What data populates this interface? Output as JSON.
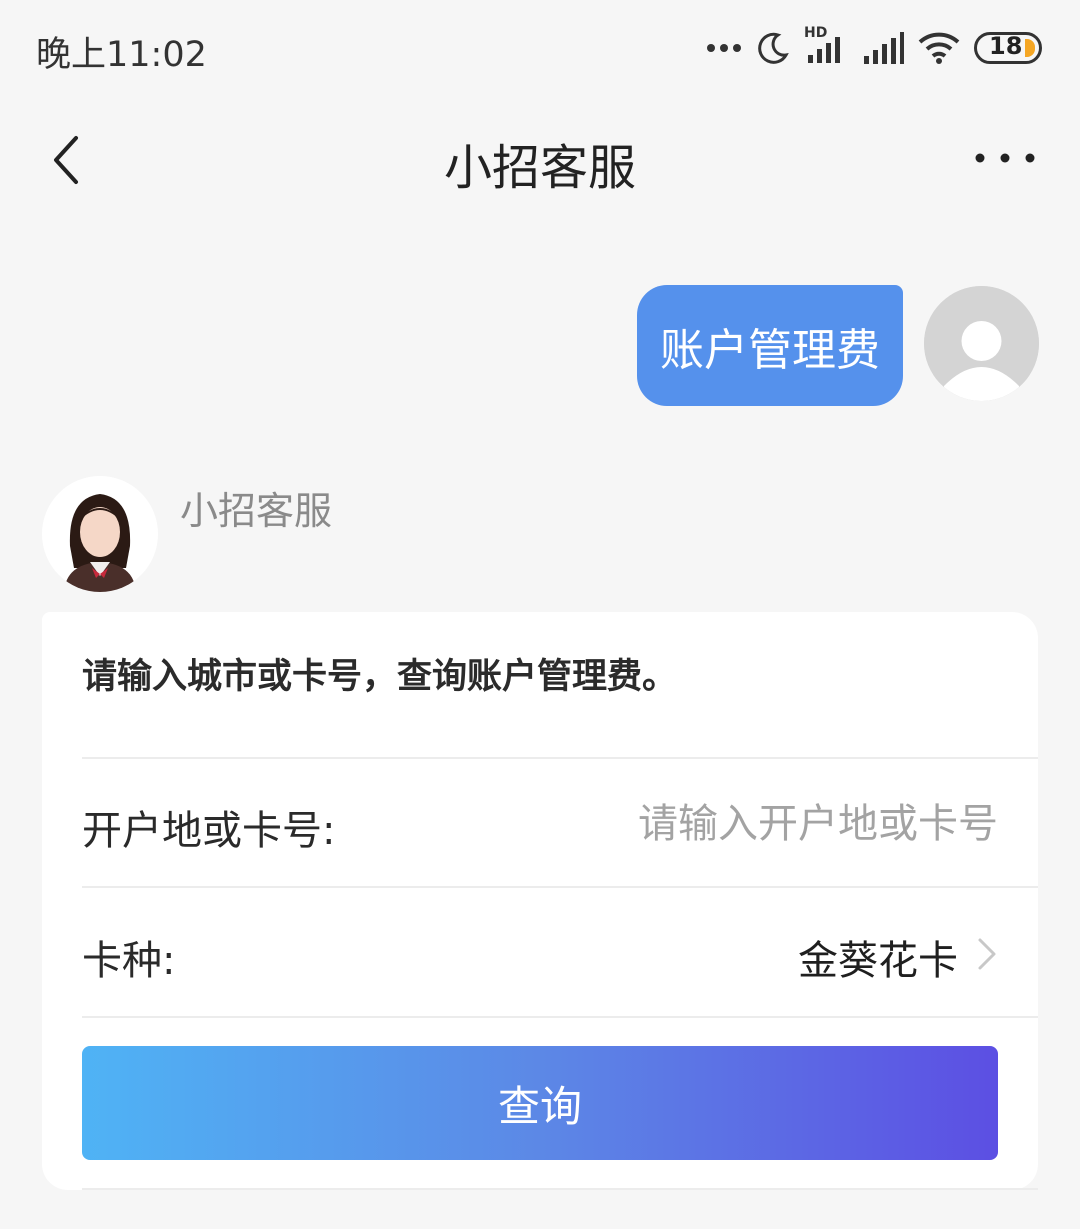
{
  "status_bar": {
    "time": "晚上11:02",
    "battery": "18",
    "network_label": "HD",
    "icons": [
      "more-dots-icon",
      "moon-icon",
      "hd-signal-icon",
      "signal-icon",
      "wifi-icon",
      "battery-icon"
    ]
  },
  "nav": {
    "title": "小招客服",
    "back_icon": "chevron-left-icon",
    "more_icon": "more-horizontal-icon"
  },
  "conversation": {
    "user_message": "账户管理费",
    "agent_name": "小招客服"
  },
  "form": {
    "prompt": "请输入城市或卡号，查询账户管理费。",
    "location_label": "开户地或卡号:",
    "location_placeholder": "请输入开户地或卡号",
    "location_value": "",
    "card_type_label": "卡种:",
    "card_type_value": "金葵花卡",
    "query_button": "查询"
  },
  "colors": {
    "background": "#f6f6f6",
    "user_bubble": "#5591ec",
    "button_gradient_start": "#4fb3f5",
    "button_gradient_end": "#5c4fe3"
  }
}
